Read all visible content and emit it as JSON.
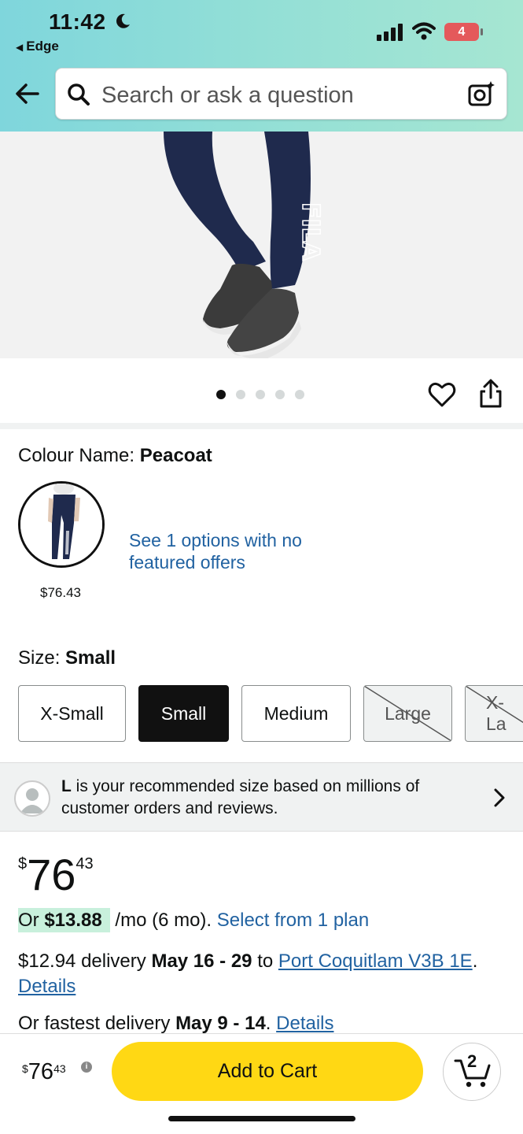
{
  "status": {
    "time": "11:42",
    "back_app": "Edge",
    "battery": "4"
  },
  "search": {
    "placeholder": "Search or ask a question"
  },
  "gallery": {
    "image_count": 5,
    "active_index": 0,
    "logo_text": "FILA"
  },
  "colour": {
    "label": "Colour Name: ",
    "value": "Peacoat",
    "swatch_price": "$76.43",
    "options_link": "See 1 options with no featured offers"
  },
  "size": {
    "label": "Size: ",
    "value": "Small",
    "options": [
      {
        "label": "X-Small",
        "state": "available"
      },
      {
        "label": "Small",
        "state": "selected"
      },
      {
        "label": "Medium",
        "state": "available"
      },
      {
        "label": "Large",
        "state": "unavailable"
      },
      {
        "label": "X-La",
        "state": "unavailable"
      }
    ]
  },
  "recommendation": {
    "size_letter": "L",
    "text": " is your recommended size based on millions of customer orders and reviews."
  },
  "price": {
    "currency": "$",
    "whole": "76",
    "fraction": "43"
  },
  "monthly": {
    "prefix": "Or ",
    "amount": "$13.88",
    "term": " /mo (6 mo). ",
    "link": "Select from 1 plan"
  },
  "delivery": {
    "cost": "$12.94 delivery ",
    "dates": "May 16 - 29",
    "to": " to ",
    "location": "Port Coquitlam V3B 1E",
    "period": ".",
    "details": "Details"
  },
  "fastest": {
    "prefix": "Or fastest delivery ",
    "dates": "May 9 - 14",
    "period": ". ",
    "details": "Details"
  },
  "bottom_bar": {
    "currency": "$",
    "whole": "76",
    "fraction": "43",
    "add_to_cart": "Add to Cart",
    "cart_count": "2"
  },
  "colors": {
    "accent_yellow": "#ffd814",
    "link_blue": "#2162a1",
    "unavailable_red": "#e4595b"
  }
}
